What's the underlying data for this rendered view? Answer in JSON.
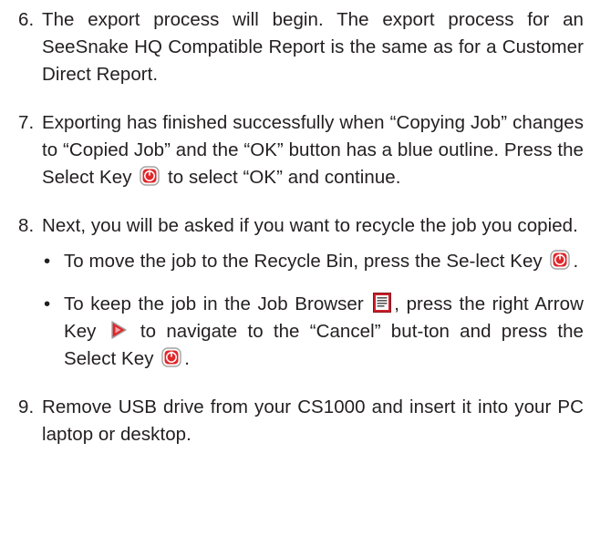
{
  "steps": [
    {
      "number": "6.",
      "text": "The export process will begin. The export process for an SeeSnake HQ Compatible Report is the same as for a Customer Direct Report."
    },
    {
      "number": "7.",
      "part1": "Exporting has finished successfully when “Copying Job” changes to “Copied Job” and the “OK” button has a blue outline. Press the Select Key",
      "part2": "to select “OK” and continue."
    },
    {
      "number": "8.",
      "text": "Next, you will be asked if you want to recycle the job you copied.",
      "bullets": [
        {
          "bullet": "•",
          "part1": "To move the job to the Recycle Bin, press the Se-lect Key",
          "part2": "."
        },
        {
          "bullet": "•",
          "part1": "To keep the job in the Job Browser",
          "part2": ", press the right Arrow Key",
          "part3": "to navigate to the “Cancel” but-ton and press the Select Key",
          "part4": "."
        }
      ]
    },
    {
      "number": "9.",
      "text": "Remove USB drive from your CS1000 and insert it into your PC laptop or desktop."
    }
  ],
  "icons": {
    "select_key": "select-key-icon",
    "job_browser": "job-browser-icon",
    "right_arrow_key": "right-arrow-key-icon"
  },
  "colors": {
    "text": "#231f20",
    "key_red": "#e0262a",
    "job_browser_red": "#c8202b"
  }
}
